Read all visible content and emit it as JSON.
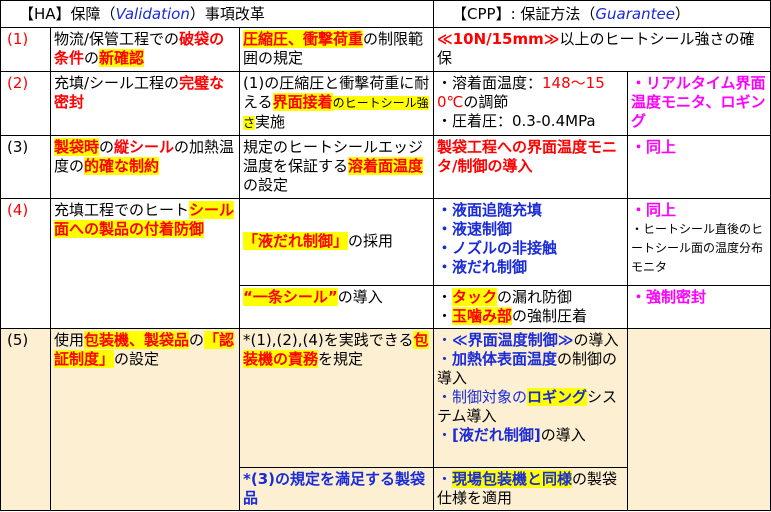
{
  "header": {
    "col_ha_prefix": "【HA】保障（",
    "col_ha_italic": "Validation",
    "col_ha_suffix": "）事項改革",
    "col_cpp_prefix": "【CPP】: 保証方法（",
    "col_cpp_italic": "Guarantee",
    "col_cpp_suffix": "）"
  },
  "rows": {
    "r1": {
      "num": "(1)",
      "c1_a": "物流/保管工程での",
      "c1_b": "破袋の条件",
      "c1_c": "の",
      "c1_d": "新確認",
      "c2_a": "圧縮圧、衝撃荷重",
      "c2_b": "の制限範囲の規定",
      "c3_a": "≪10N/15mm≫",
      "c3_b": "以上のヒートシール強さの確保"
    },
    "r2": {
      "num": "(2)",
      "c1_a": "充填/シール工程の",
      "c1_b": "完璧な密封",
      "c2_a": "(1)の圧縮圧と衝撃荷重に耐える",
      "c2_b": "界面接着",
      "c2_c": "のヒートシール強さ",
      "c2_d": "実施",
      "c3_a": "・溶着面温度：",
      "c3_b": "148～150℃",
      "c3_c": "の調節",
      "c3_d": "・圧着圧：0.3-0.4MPa",
      "c4": "・リアルタイム界面温度モニタ、ロギング"
    },
    "r3": {
      "num": "(3)",
      "c1_a": "製袋時",
      "c1_b": "の",
      "c1_c": "縦シール",
      "c1_d": "の加熱温度の",
      "c1_e": "的確な制約",
      "c2_a": "規定のヒートシールエッジ温度を保証する",
      "c2_b": "溶着面温度",
      "c2_c": "の設定",
      "c3": "製袋工程への界面温度モニタ/制御の導入",
      "c4": "・同上"
    },
    "r4": {
      "num": "(4)",
      "c1_a": "充填工程でのヒート",
      "c1_b": "シール面への製品の付着防御",
      "c2_a": "「液だれ制御」",
      "c2_b": "の採用",
      "c3_1": "・液面追随充填",
      "c3_2": "・液速制御",
      "c3_3": "・ノズルの非接触",
      "c3_4": "・液だれ制御",
      "c4_a": "・同上",
      "c4_b": "・ヒートシール直後のヒートシール面の温度分布モニタ"
    },
    "r4b": {
      "c2_a": "“一条シール”",
      "c2_b": "の導入",
      "c3_a": "・",
      "c3_b": "タック",
      "c3_c": "の漏れ防御",
      "c3_d": "・",
      "c3_e": "玉噛み部",
      "c3_f": "の強制圧着",
      "c4": "・強制密封"
    },
    "r5": {
      "num": "(5)",
      "c1_a": "使用",
      "c1_b": "包装機、製袋品",
      "c1_c": "の",
      "c1_d": "「認証制度」",
      "c1_e": "の設定",
      "c2_a": "*(1),(2),(4)を実践できる",
      "c2_b": "包装機の責務",
      "c2_c": "を規定",
      "c3_1a": "・",
      "c3_1b": "≪界面温度制御≫",
      "c3_1c": "の導入",
      "c3_2a": "・",
      "c3_2b": "加熱体表面温度",
      "c3_2c": "の制御の導入",
      "c3_3a": "・制御対象の",
      "c3_3b": "ロギング",
      "c3_3c": "システム導入",
      "c3_4a": "・",
      "c3_4b": "[液だれ制御]",
      "c3_4c": "の導入"
    },
    "r5b": {
      "c2": "*(3)の規定を満足する製袋品",
      "c3_a": "・",
      "c3_b": "現場包装機と同様",
      "c3_c": "の製袋仕様を適用"
    }
  }
}
